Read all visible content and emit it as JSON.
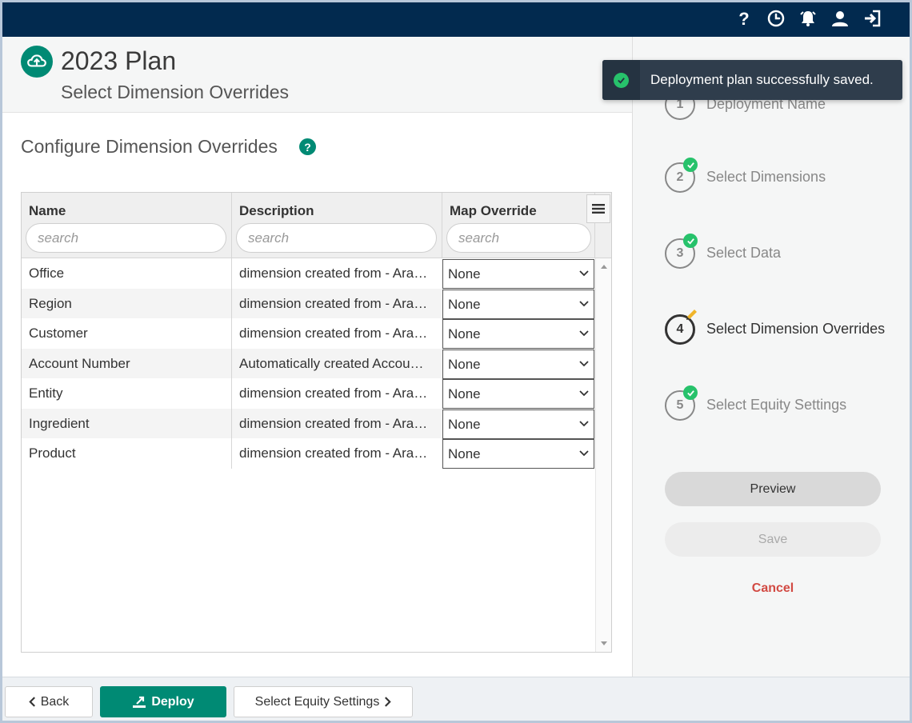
{
  "topbar": {
    "icons": [
      "help-icon",
      "history-icon",
      "alarm-icon",
      "user-icon",
      "logout-icon"
    ],
    "bg_color": "#022a4f"
  },
  "header": {
    "title": "2023 Plan",
    "subtitle": "Select Dimension Overrides",
    "logo_icon": "cloud-upload-icon",
    "accent_color": "#008a74"
  },
  "section": {
    "title": "Configure Dimension Overrides",
    "help": "?"
  },
  "grid": {
    "columns": [
      {
        "label": "Name",
        "placeholder": "search"
      },
      {
        "label": "Description",
        "placeholder": "search"
      },
      {
        "label": "Map Override",
        "placeholder": "search"
      }
    ],
    "rows": [
      {
        "name": "Office",
        "description": "dimension created from - Ara…",
        "override": "None"
      },
      {
        "name": "Region",
        "description": "dimension created from - Ara…",
        "override": "None"
      },
      {
        "name": "Customer",
        "description": "dimension created from - Ara…",
        "override": "None"
      },
      {
        "name": "Account Number",
        "description": "Automatically created Accou…",
        "override": "None"
      },
      {
        "name": "Entity",
        "description": "dimension created from - Ara…",
        "override": "None"
      },
      {
        "name": "Ingredient",
        "description": "dimension created from - Ara…",
        "override": "None"
      },
      {
        "name": "Product",
        "description": "dimension created from - Ara…",
        "override": "None"
      }
    ]
  },
  "steps": [
    {
      "number": "1",
      "label": "Deployment Name",
      "status": "complete"
    },
    {
      "number": "2",
      "label": "Select Dimensions",
      "status": "complete"
    },
    {
      "number": "3",
      "label": "Select Data",
      "status": "complete"
    },
    {
      "number": "4",
      "label": "Select Dimension Overrides",
      "status": "active"
    },
    {
      "number": "5",
      "label": "Select Equity Settings",
      "status": "complete"
    }
  ],
  "actions": {
    "preview": "Preview",
    "save": "Save",
    "cancel": "Cancel"
  },
  "toast": {
    "message": "Deployment plan successfully saved.",
    "status_color": "#27c26b"
  },
  "footer": {
    "back": "Back",
    "deploy": "Deploy",
    "next": "Select Equity Settings"
  }
}
